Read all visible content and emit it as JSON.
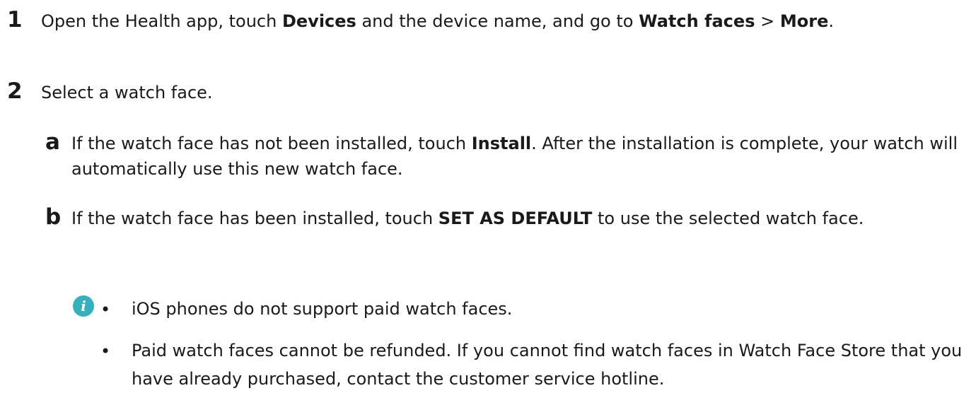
{
  "steps": [
    {
      "number": "1",
      "segments": [
        {
          "text": "Open the Health app, touch ",
          "bold": false
        },
        {
          "text": "Devices",
          "bold": true
        },
        {
          "text": " and the device name, and go to ",
          "bold": false
        },
        {
          "text": "Watch faces",
          "bold": true
        },
        {
          "text": " > ",
          "bold": false
        },
        {
          "text": "More",
          "bold": true
        },
        {
          "text": ".",
          "bold": false
        }
      ]
    },
    {
      "number": "2",
      "segments": [
        {
          "text": "Select a watch face.",
          "bold": false
        }
      ]
    }
  ],
  "substeps": [
    {
      "letter": "a",
      "segments": [
        {
          "text": "If the watch face has not been installed, touch ",
          "bold": false
        },
        {
          "text": "Install",
          "bold": true
        },
        {
          "text": ". After the installation is complete, your watch will automatically use this new watch face.",
          "bold": false
        }
      ]
    },
    {
      "letter": "b",
      "segments": [
        {
          "text": "If the watch face has been installed, touch ",
          "bold": false
        },
        {
          "text": "SET AS DEFAULT",
          "bold": true
        },
        {
          "text": " to use the selected watch face.",
          "bold": false
        }
      ]
    }
  ],
  "note": {
    "icon": "info-icon",
    "icon_glyph": "i",
    "icon_color": "#33b2bd",
    "bullet_glyph": "•",
    "items": [
      "iOS phones do not support paid watch faces.",
      "Paid watch faces cannot be refunded. If you cannot find watch faces in Watch Face Store that you have already purchased, contact the customer service hotline."
    ]
  }
}
